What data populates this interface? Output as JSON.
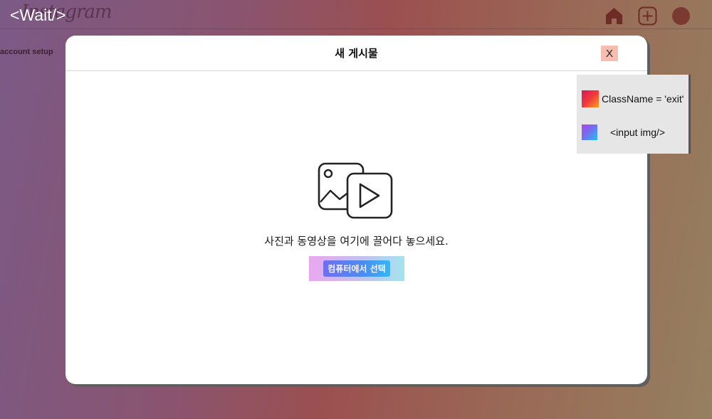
{
  "header": {
    "logo_script": "Instagram",
    "logo_overlay": "<Wait/>",
    "icons": [
      "home-icon",
      "add-post-icon",
      "profile-avatar"
    ]
  },
  "sidebar": {
    "label": "account setup"
  },
  "modal": {
    "title": "새 게시물",
    "close_label": "X",
    "drop_text": "사진과 동영상을 여기에 끌어다 놓으세요.",
    "select_button_label": "컴퓨터에서 선택",
    "media_icon": "photo-video-icon"
  },
  "legend": {
    "items": [
      {
        "label": "ClassName = 'exit'"
      },
      {
        "label": "<input img/>"
      }
    ]
  },
  "colors": {
    "close_button_bg": "#f7bdb0",
    "select_button_start": "#6f6ff0",
    "select_button_end": "#33b8f5",
    "legend_bg": "#e6e6e6"
  }
}
